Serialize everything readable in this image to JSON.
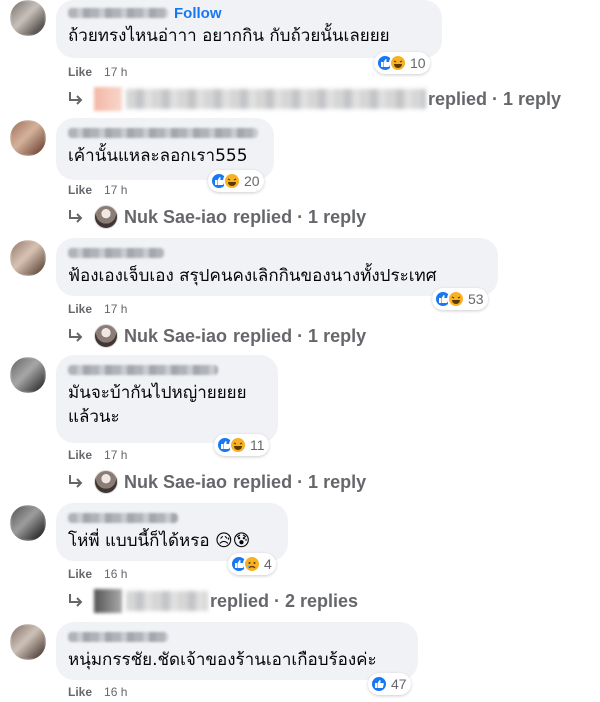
{
  "comments": [
    {
      "follow_label": "Follow",
      "text": "ถ้วยทรงไหนอ่าาา อยากกิน กับถ้วยนั้นเลยยย",
      "reactions": [
        "like",
        "haha"
      ],
      "reaction_count": "10",
      "like_label": "Like",
      "time": "17 h",
      "replies": {
        "replier": "",
        "label": "replied · 1 reply"
      }
    },
    {
      "text": "เค้านั้นแหละลอกเรา555",
      "reactions": [
        "like",
        "haha"
      ],
      "reaction_count": "20",
      "like_label": "Like",
      "time": "17 h",
      "replies": {
        "replier": "Nuk Sae-iao",
        "label": "replied · 1 reply"
      }
    },
    {
      "text": "ฟ้องเองเจ็บเอง สรุปคนคงเลิกกินของนางทั้งประเทศ",
      "reactions": [
        "like",
        "haha"
      ],
      "reaction_count": "53",
      "like_label": "Like",
      "time": "17 h",
      "replies": {
        "replier": "Nuk Sae-iao",
        "label": "replied · 1 reply"
      }
    },
    {
      "text": "มันจะบ้ากันไปหญ่ายยยย\nแล้วนะ",
      "reactions": [
        "like",
        "haha"
      ],
      "reaction_count": "11",
      "like_label": "Like",
      "time": "17 h",
      "replies": {
        "replier": "Nuk Sae-iao",
        "label": "replied · 1 reply"
      }
    },
    {
      "text": "โห่พี่ แบบนี้ก็ได้หรอ 😥😰",
      "reactions": [
        "like",
        "sad"
      ],
      "reaction_count": "4",
      "like_label": "Like",
      "time": "16 h",
      "replies": {
        "replier": "",
        "label": "replied · 2 replies"
      }
    },
    {
      "text": "หนุ่มกรรชัย.ชัดเจ้าของร้านเอาเกือบร้องค่ะ",
      "reactions": [
        "like"
      ],
      "reaction_count": "47",
      "like_label": "Like",
      "time": "16 h"
    }
  ],
  "colors": {
    "bubble_bg": "#f0f2f5",
    "meta_text": "#65676b",
    "link_blue": "#1877f2",
    "like_blue": "#1877f2",
    "haha_yellow": "#f7b125"
  },
  "icons": {
    "like": "thumbs-up-icon",
    "haha": "laughing-face-icon",
    "sad": "sad-face-icon",
    "reply": "reply-arrow-icon"
  }
}
